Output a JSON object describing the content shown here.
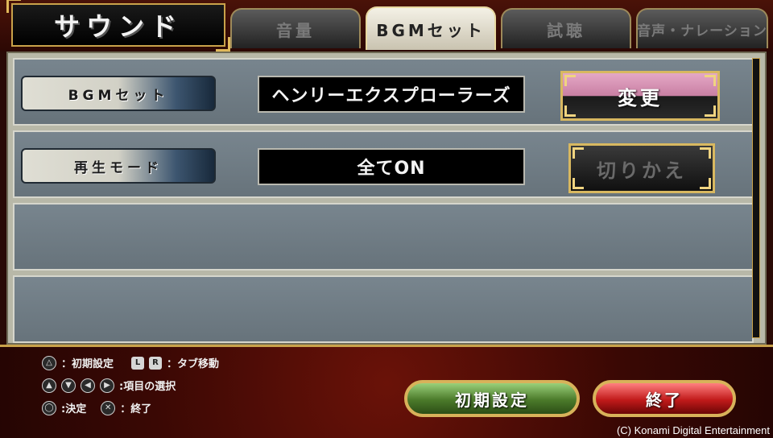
{
  "header": {
    "title": "サウンド",
    "tabs": [
      {
        "label": "音量",
        "active": false
      },
      {
        "label": "BGMセット",
        "active": true
      },
      {
        "label": "試聴",
        "active": false
      },
      {
        "label": "音声・ナレーション",
        "active": false
      }
    ]
  },
  "settings": [
    {
      "label": "BGMセット",
      "value": "ヘンリーエクスプローラーズ",
      "button": "変更",
      "button_enabled": true
    },
    {
      "label": "再生モード",
      "value": "全てON",
      "button": "切りかえ",
      "button_enabled": false
    }
  ],
  "footer": {
    "help": {
      "triangle": "：初期設定",
      "lr": "：タブ移動",
      "dpad": ":項目の選択",
      "circle": ":決定",
      "cross": "：終了"
    },
    "icons": {
      "triangle": "triangle-icon",
      "circle": "circle-icon",
      "cross": "cross-icon",
      "l": "L",
      "r": "R"
    },
    "reset_button": "初期設定",
    "exit_button": "終了",
    "copyright": "(C) Konami Digital Entertainment"
  },
  "colors": {
    "accent_gold": "#c9a24a",
    "background_red": "#3a0804",
    "reset_green": "#4b7a2a",
    "exit_red": "#c11a1a"
  }
}
